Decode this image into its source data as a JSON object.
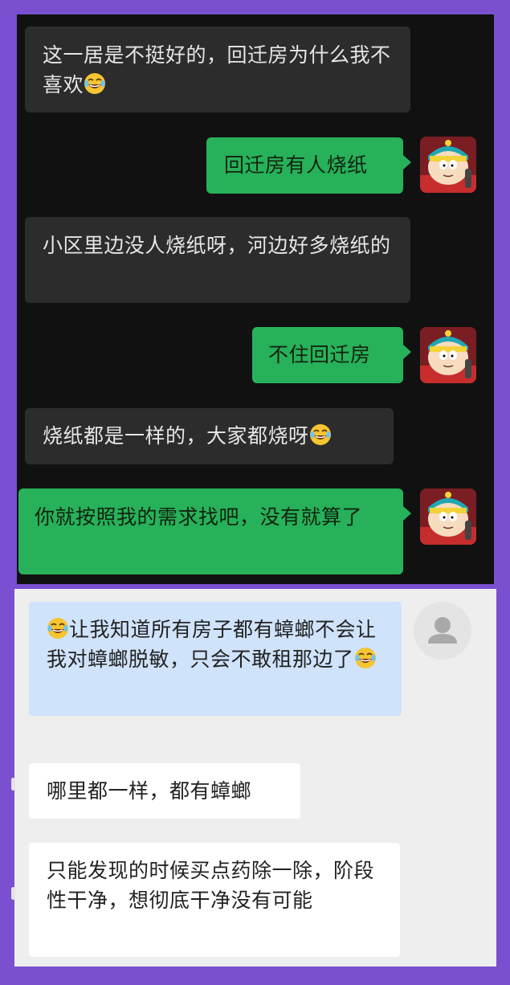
{
  "dark_chat": {
    "messages": [
      {
        "side": "in",
        "text": "这一居是不挺好的，回迁房为什么我不喜欢",
        "emoji_end": true
      },
      {
        "side": "out",
        "text": "回迁房有人烧纸"
      },
      {
        "side": "in",
        "text": "小区里边没人烧纸呀，河边好多烧纸的"
      },
      {
        "side": "out",
        "text": "不住回迁房"
      },
      {
        "side": "in",
        "text": "烧纸都是一样的，大家都烧呀",
        "emoji_end": true
      },
      {
        "side": "out",
        "text": "你就按照我的需求找吧，没有就算了"
      }
    ],
    "avatar_icon": "cartoon-boy-avatar-icon"
  },
  "light_chat": {
    "messages": [
      {
        "style": "blue",
        "text": "让我知道所有房子都有蟑螂不会让我对蟑螂脱敏，只会不敢租那边了",
        "emoji_start": true,
        "emoji_end": true
      },
      {
        "style": "white",
        "text": "哪里都一样，都有蟑螂"
      },
      {
        "style": "white",
        "text": "只能发现的时候买点药除一除，阶段性干净，想彻底干净没有可能"
      }
    ],
    "avatar_icon": "default-user-avatar-icon"
  },
  "colors": {
    "frame": "#7a4fd0",
    "dark_bg": "#111111",
    "green_bubble": "#27b15a",
    "dark_bubble": "#2c2c2c",
    "blue_bubble": "#cfe3fb"
  }
}
